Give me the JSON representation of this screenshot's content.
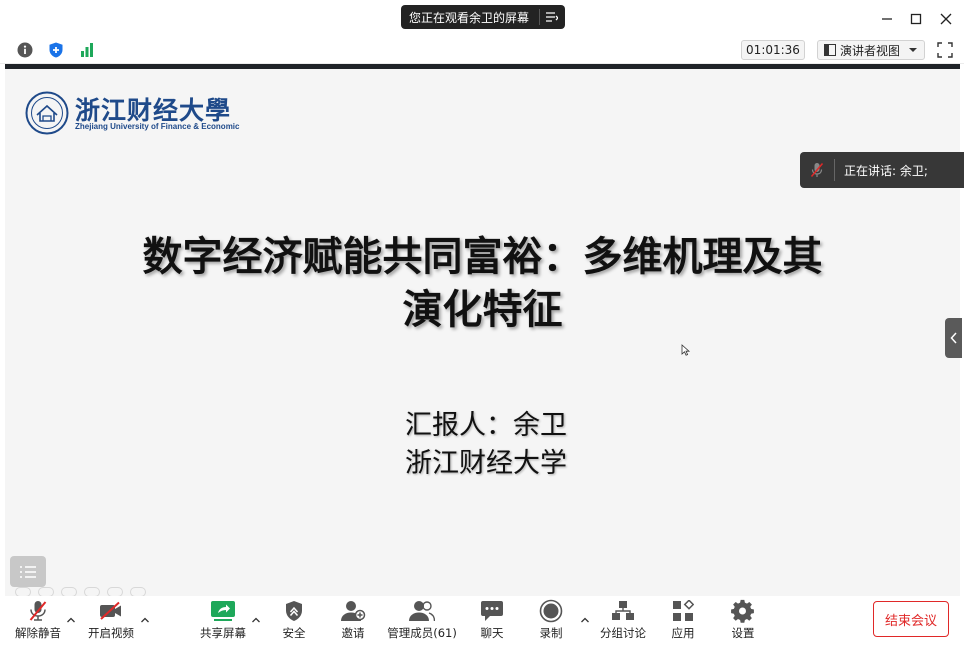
{
  "window": {
    "share_banner": "您正在观看余卫的屏幕",
    "buttons": [
      "minimize-icon",
      "maximize-icon",
      "close-icon"
    ]
  },
  "toolbar": {
    "timer": "01:01:36",
    "view_label": "演讲者视图",
    "icons": [
      "info-icon",
      "shield-icon",
      "signal-icon",
      "fullscreen-icon"
    ]
  },
  "slide": {
    "logo_cn": "浙江财经大學",
    "logo_en": "Zhejiang University of Finance & Economic",
    "title_line1": "数字经济赋能共同富裕：多维机理及其",
    "title_line2": "演化特征",
    "presenter_line": "汇报人：余卫",
    "affiliation": "浙江财经大学"
  },
  "speaking": {
    "label": "正在讲话: 余卫;"
  },
  "controls": {
    "unmute": "解除静音",
    "start_video": "开启视频",
    "share_screen": "共享屏幕",
    "security": "安全",
    "invite": "邀请",
    "participants": "管理成员(61)",
    "chat": "聊天",
    "record": "录制",
    "breakout": "分组讨论",
    "apps": "应用",
    "settings": "设置",
    "end": "结束会议"
  },
  "colors": {
    "accent_blue": "#1a73e8",
    "end_red": "#e02828",
    "share_green": "#1ea85a",
    "logo_blue": "#1f4a8a"
  }
}
